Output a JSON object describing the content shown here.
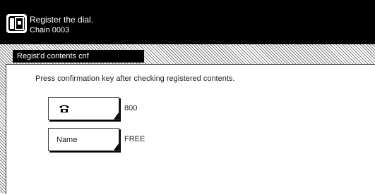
{
  "header": {
    "line1": "Register the dial.",
    "line2": "Chain 0003",
    "icon": "fax-panel-icon"
  },
  "panel": {
    "title": "Regist'd contents cnf",
    "instruction": "Press confirmation key after checking registered contents."
  },
  "entries": {
    "phone": {
      "icon": "telephone-icon",
      "value": "800"
    },
    "name": {
      "label": "Name",
      "value": "FREE"
    }
  }
}
